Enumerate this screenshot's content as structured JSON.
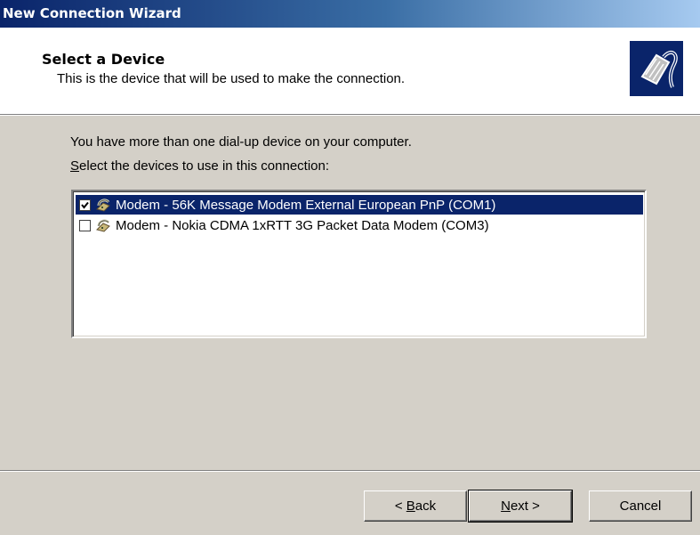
{
  "window": {
    "title": "New Connection Wizard"
  },
  "header": {
    "title": "Select a Device",
    "subtitle": "This is the device that will be used to make the connection.",
    "icon": "network-cable-icon"
  },
  "body": {
    "intro": "You have more than one dial-up device on your computer.",
    "select_label_accel": "S",
    "select_label_rest": "elect the devices to use in this connection:"
  },
  "devices": [
    {
      "label": "Modem - 56K Message Modem External European PnP (COM1)",
      "checked": true,
      "selected": true,
      "icon": "modem-icon"
    },
    {
      "label": "Modem - Nokia CDMA 1xRTT 3G Packet Data Modem (COM3)",
      "checked": false,
      "selected": false,
      "icon": "modem-icon"
    }
  ],
  "buttons": {
    "back_prefix": "< ",
    "back_accel": "B",
    "back_rest": "ack",
    "next_accel": "N",
    "next_rest": "ext >",
    "cancel": "Cancel"
  },
  "colors": {
    "selection": "#0a246a",
    "dialog_bg": "#d4d0c8",
    "title_gradient_start": "#0a246a",
    "title_gradient_end": "#a6caf0"
  }
}
